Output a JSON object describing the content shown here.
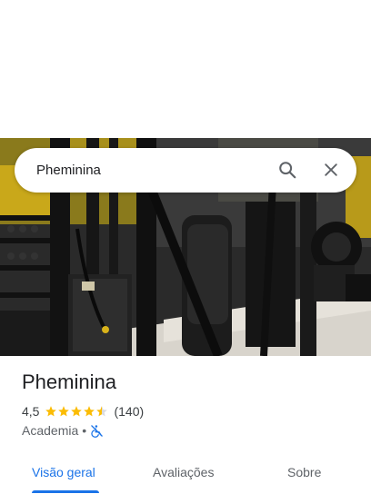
{
  "search": {
    "value": "Pheminina"
  },
  "place": {
    "name": "Pheminina",
    "rating": "4,5",
    "stars": 4.5,
    "review_count": "(140)",
    "category": "Academia",
    "separator": "•"
  },
  "tabs": [
    {
      "label": "Visão geral",
      "active": true
    },
    {
      "label": "Avaliações",
      "active": false
    },
    {
      "label": "Sobre",
      "active": false
    }
  ],
  "colors": {
    "accent": "#1a73e8",
    "star": "#fbbc04",
    "wheelchair_icon": "#1a73e8"
  },
  "icons": {
    "search": "search-icon",
    "close": "close-icon",
    "accessibility": "wheelchair-inaccessible-icon"
  }
}
